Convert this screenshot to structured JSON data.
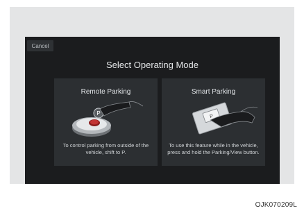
{
  "screen": {
    "cancel_label": "Cancel",
    "title": "Select Operating Mode"
  },
  "cards": [
    {
      "title": "Remote Parking",
      "illustration_icon": "car-key-fob-icon",
      "description": "To control parking from outside of the vehicle, shift to P."
    },
    {
      "title": "Smart Parking",
      "illustration_icon": "hand-pressing-parking-button-icon",
      "description": "To use this feature while in the vehicle, press and hold the Parking/View button."
    }
  ],
  "figure_code": "OJK070209L",
  "colors": {
    "screen_bg": "#1b1c1e",
    "card_bg": "#2c2f32",
    "frame_bg": "#e4e5e6"
  }
}
